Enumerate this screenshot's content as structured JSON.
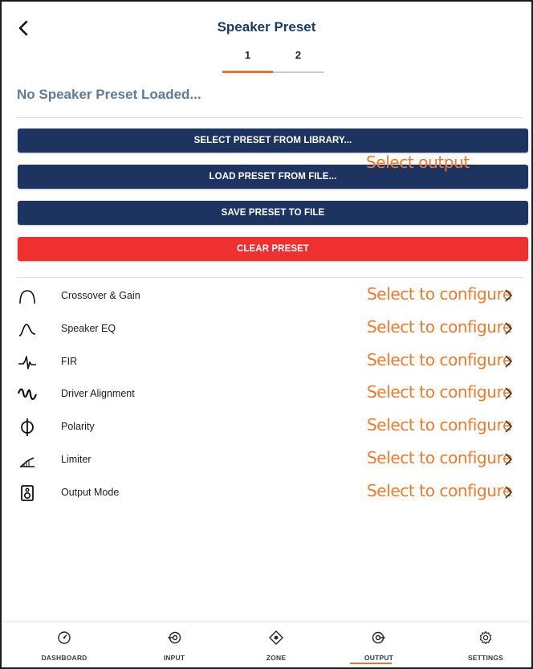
{
  "header": {
    "title": "Speaker Preset",
    "back_icon": "chevron-left-icon"
  },
  "tabs": [
    {
      "label": "1",
      "active": true
    },
    {
      "label": "2",
      "active": false
    }
  ],
  "status_text": "No Speaker Preset Loaded...",
  "actions": {
    "select_library": "SELECT PRESET FROM LIBRARY...",
    "load_file": "LOAD PRESET FROM FILE...",
    "save_file": "SAVE PRESET TO FILE",
    "clear": "CLEAR PRESET"
  },
  "overlay_text": "Select output",
  "config_items": [
    {
      "label": "Crossover & Gain",
      "value": "Select to configure",
      "icon": "crossover-curve-icon"
    },
    {
      "label": "Speaker EQ",
      "value": "Select to configure",
      "icon": "eq-curve-icon"
    },
    {
      "label": "FIR",
      "value": "Select to configure",
      "icon": "fir-impulse-icon"
    },
    {
      "label": "Driver Alignment",
      "value": "Select to configure",
      "icon": "driver-alignment-icon"
    },
    {
      "label": "Polarity",
      "value": "Select to configure",
      "icon": "polarity-phi-icon"
    },
    {
      "label": "Limiter",
      "value": "Select to configure",
      "icon": "limiter-icon"
    },
    {
      "label": "Output Mode",
      "value": "Select to configure",
      "icon": "speaker-box-icon"
    }
  ],
  "bottom_nav": [
    {
      "label": "DASHBOARD",
      "icon": "gauge-icon",
      "active": false
    },
    {
      "label": "INPUT",
      "icon": "input-icon",
      "active": false
    },
    {
      "label": "ZONE",
      "icon": "zone-icon",
      "active": false
    },
    {
      "label": "OUTPUT",
      "icon": "output-icon",
      "active": true
    },
    {
      "label": "SETTINGS",
      "icon": "gear-icon",
      "active": false
    }
  ],
  "colors": {
    "navy": "#1d3461",
    "title_blue": "#1b3a66",
    "status_blue": "#5e7a99",
    "accent_orange": "#e8722a",
    "annotation_orange": "#f0792b",
    "danger_red": "#ee3030"
  }
}
